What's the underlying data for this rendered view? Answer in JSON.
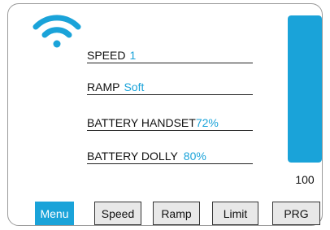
{
  "status": {
    "speed": {
      "label": "SPEED",
      "value": "1"
    },
    "ramp": {
      "label": "RAMP",
      "value": "Soft"
    },
    "battery_handset": {
      "label": "BATTERY HANDSET",
      "value": "72%"
    },
    "battery_dolly": {
      "label": "BATTERY DOLLY",
      "value": "80%"
    }
  },
  "level_bar": {
    "value": "100",
    "fill_fraction": 1.0
  },
  "buttons": {
    "menu": "Menu",
    "speed": "Speed",
    "ramp": "Ramp",
    "limit": "Limit",
    "prg": "PRG"
  },
  "icons": {
    "wifi": "wifi-icon"
  },
  "colors": {
    "accent": "#1aa3d9",
    "button_bg": "#e8e8e8",
    "text": "#111111"
  }
}
